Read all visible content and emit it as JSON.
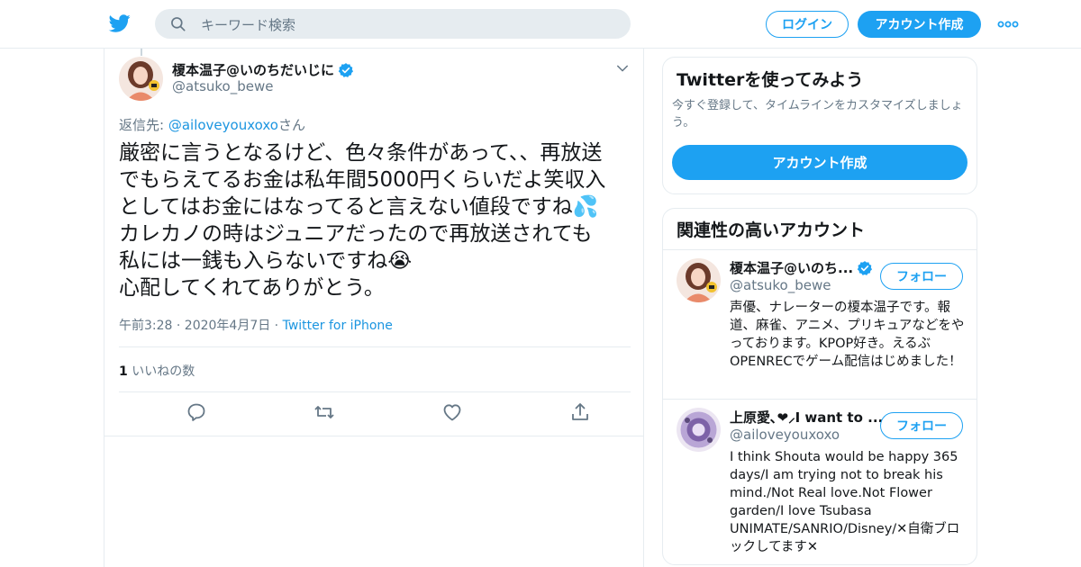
{
  "header": {
    "logo_icon": "twitter-bird-icon",
    "search_placeholder": "キーワード検索",
    "login_label": "ログイン",
    "signup_label": "アカウント作成",
    "more_icon": "more-dots-icon"
  },
  "tweet": {
    "author_name": "榎本温子@いのちだいじに",
    "author_handle": "@atsuko_bewe",
    "reply_prefix": "返信先: ",
    "reply_mention": "@ailoveyouxoxo",
    "reply_suffix": "さん",
    "text": "厳密に言うとなるけど、色々条件があって、、再放送\nでもらえてるお金は私年間5000円くらいだよ笑収入\nとしてはお金にはなってると言えない値段ですね💦\nカレカノの時はジュニアだったので再放送されても\n私には一銭も入らないですね😭\n心配してくれてありがとう。",
    "time": "午前3:28 · 2020年4月7日 · ",
    "client": "Twitter for iPhone",
    "likes_count": "1",
    "likes_label": " いいねの数"
  },
  "sidebar": {
    "signup_card": {
      "title": "Twitterを使ってみよう",
      "description": "今すぐ登録して、タイムラインをカスタマイズしましょう。",
      "button": "アカウント作成"
    },
    "related": {
      "title": "関連性の高いアカウント",
      "accounts": [
        {
          "name": "榎本温子@いのち...",
          "handle": "@atsuko_bewe",
          "follow": "フォロー",
          "bio": "声優、ナレーターの榎本温子です。報道、麻雀、アニメ、プリキュアなどをやっております。KPOP好き。えるぶOPENRECでゲーム配信はじめました！"
        },
        {
          "name": "上原愛､❤⸝I want to ...",
          "handle": "@ailoveyouxoxo",
          "follow": "フォロー",
          "bio": "I think Shouta would be happy 365 days/I am trying not to break his mind./Not Real love.Not Flower garden/I love Tsubasa UNIMATE/SANRIO/Disney/✕自衛ブロックしてます✕"
        }
      ]
    }
  },
  "colors": {
    "accent": "#1da1f2",
    "link": "#1b95e0",
    "muted": "#657786",
    "border": "#e6ecf0"
  }
}
